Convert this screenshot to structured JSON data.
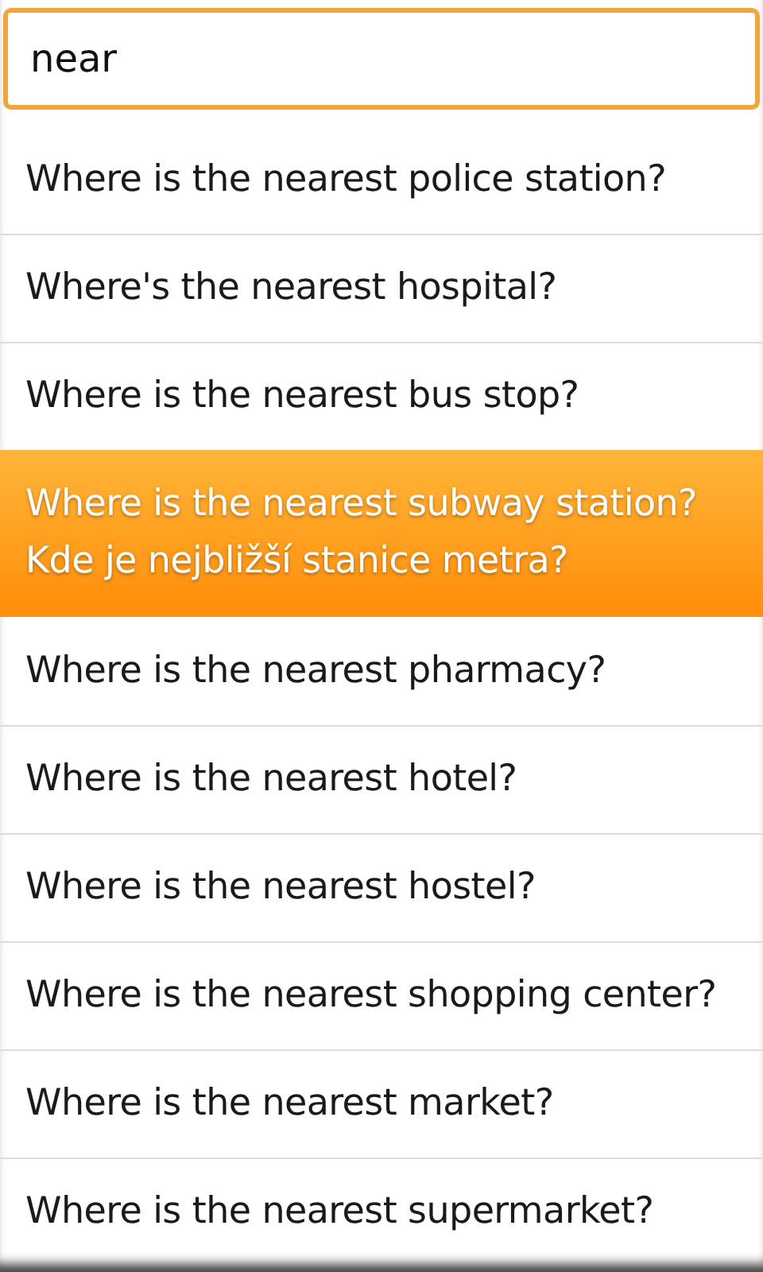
{
  "search": {
    "value": "near"
  },
  "results": [
    {
      "text": "Where is the nearest police station?",
      "selected": false
    },
    {
      "text": "Where's the nearest hospital?",
      "selected": false
    },
    {
      "text": "Where is the nearest bus stop?",
      "selected": false
    },
    {
      "text": "Where is the nearest subway station?",
      "translation": "Kde je nejbližší stanice metra?",
      "selected": true
    },
    {
      "text": "Where is the nearest pharmacy?",
      "selected": false
    },
    {
      "text": "Where is the nearest hotel?",
      "selected": false
    },
    {
      "text": "Where is the nearest hostel?",
      "selected": false
    },
    {
      "text": "Where is the nearest shopping center?",
      "selected": false
    },
    {
      "text": "Where is the nearest market?",
      "selected": false
    },
    {
      "text": "Where is the nearest supermarket?",
      "selected": false
    }
  ]
}
